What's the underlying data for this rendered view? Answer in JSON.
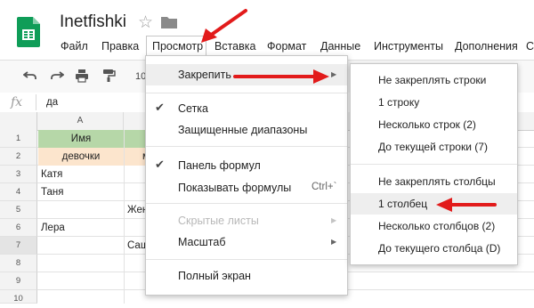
{
  "header": {
    "doc_title": "Inetfishki"
  },
  "menubar": {
    "items": [
      "Файл",
      "Правка",
      "Просмотр",
      "Вставка",
      "Формат",
      "Данные",
      "Инструменты",
      "Дополнения",
      "С"
    ]
  },
  "toolbar": {
    "zoom": "10"
  },
  "formula_bar": {
    "fx": "fx",
    "value": "да"
  },
  "grid": {
    "columns": [
      "A",
      "F"
    ],
    "rows": [
      "1",
      "2",
      "3",
      "4",
      "5",
      "6",
      "7",
      "8",
      "9",
      "10"
    ],
    "cells": {
      "a1": "Имя",
      "a2": "девочки",
      "a3": "Катя",
      "a4": "Таня",
      "a6": "Лера",
      "b2": "м",
      "b5": "Жен",
      "b7": "Саш"
    }
  },
  "view_menu": {
    "freeze": "Закрепить",
    "grid": "Сетка",
    "protected_ranges": "Защищенные диапазоны",
    "formula_bar": "Панель формул",
    "show_formulas": "Показывать формулы",
    "show_formulas_shortcut": "Ctrl+`",
    "hidden_sheets": "Скрытые листы",
    "zoom": "Масштаб",
    "full_screen": "Полный экран"
  },
  "freeze_menu": {
    "no_rows": "Не закреплять строки",
    "one_row": "1 строку",
    "multiple_rows": "Несколько строк (2)",
    "up_to_row": "До текущей строки (7)",
    "no_columns": "Не закреплять столбцы",
    "one_column": "1 столбец",
    "multiple_columns": "Несколько столбцов (2)",
    "up_to_column": "До текущего столбца (D)"
  },
  "colors": {
    "logo_green": "#0f9d58",
    "header_green_cell": "#b6d7a8",
    "header_yellow_cell": "#fce5cd",
    "arrow_red": "#e21b1b"
  },
  "icons": [
    "sheets-logo-icon",
    "star-icon",
    "folder-icon",
    "undo-icon",
    "redo-icon",
    "print-icon",
    "paint-format-icon",
    "checkmark-icon",
    "submenu-arrow-icon"
  ]
}
